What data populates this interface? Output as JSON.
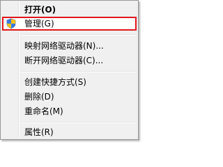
{
  "context_menu": {
    "items": [
      {
        "label": "打开(O)"
      },
      {
        "label": "管理(G)",
        "icon": "uac-shield-icon"
      },
      {
        "label": "映射网络驱动器(N)..."
      },
      {
        "label": "断开网络驱动器(C)..."
      },
      {
        "label": "创建快捷方式(S)"
      },
      {
        "label": "删除(D)"
      },
      {
        "label": "重命名(M)"
      },
      {
        "label": "属性(R)"
      }
    ],
    "selected_index": 1,
    "highlight_color": "#e0161c",
    "background_color": "#f0f0f0"
  }
}
